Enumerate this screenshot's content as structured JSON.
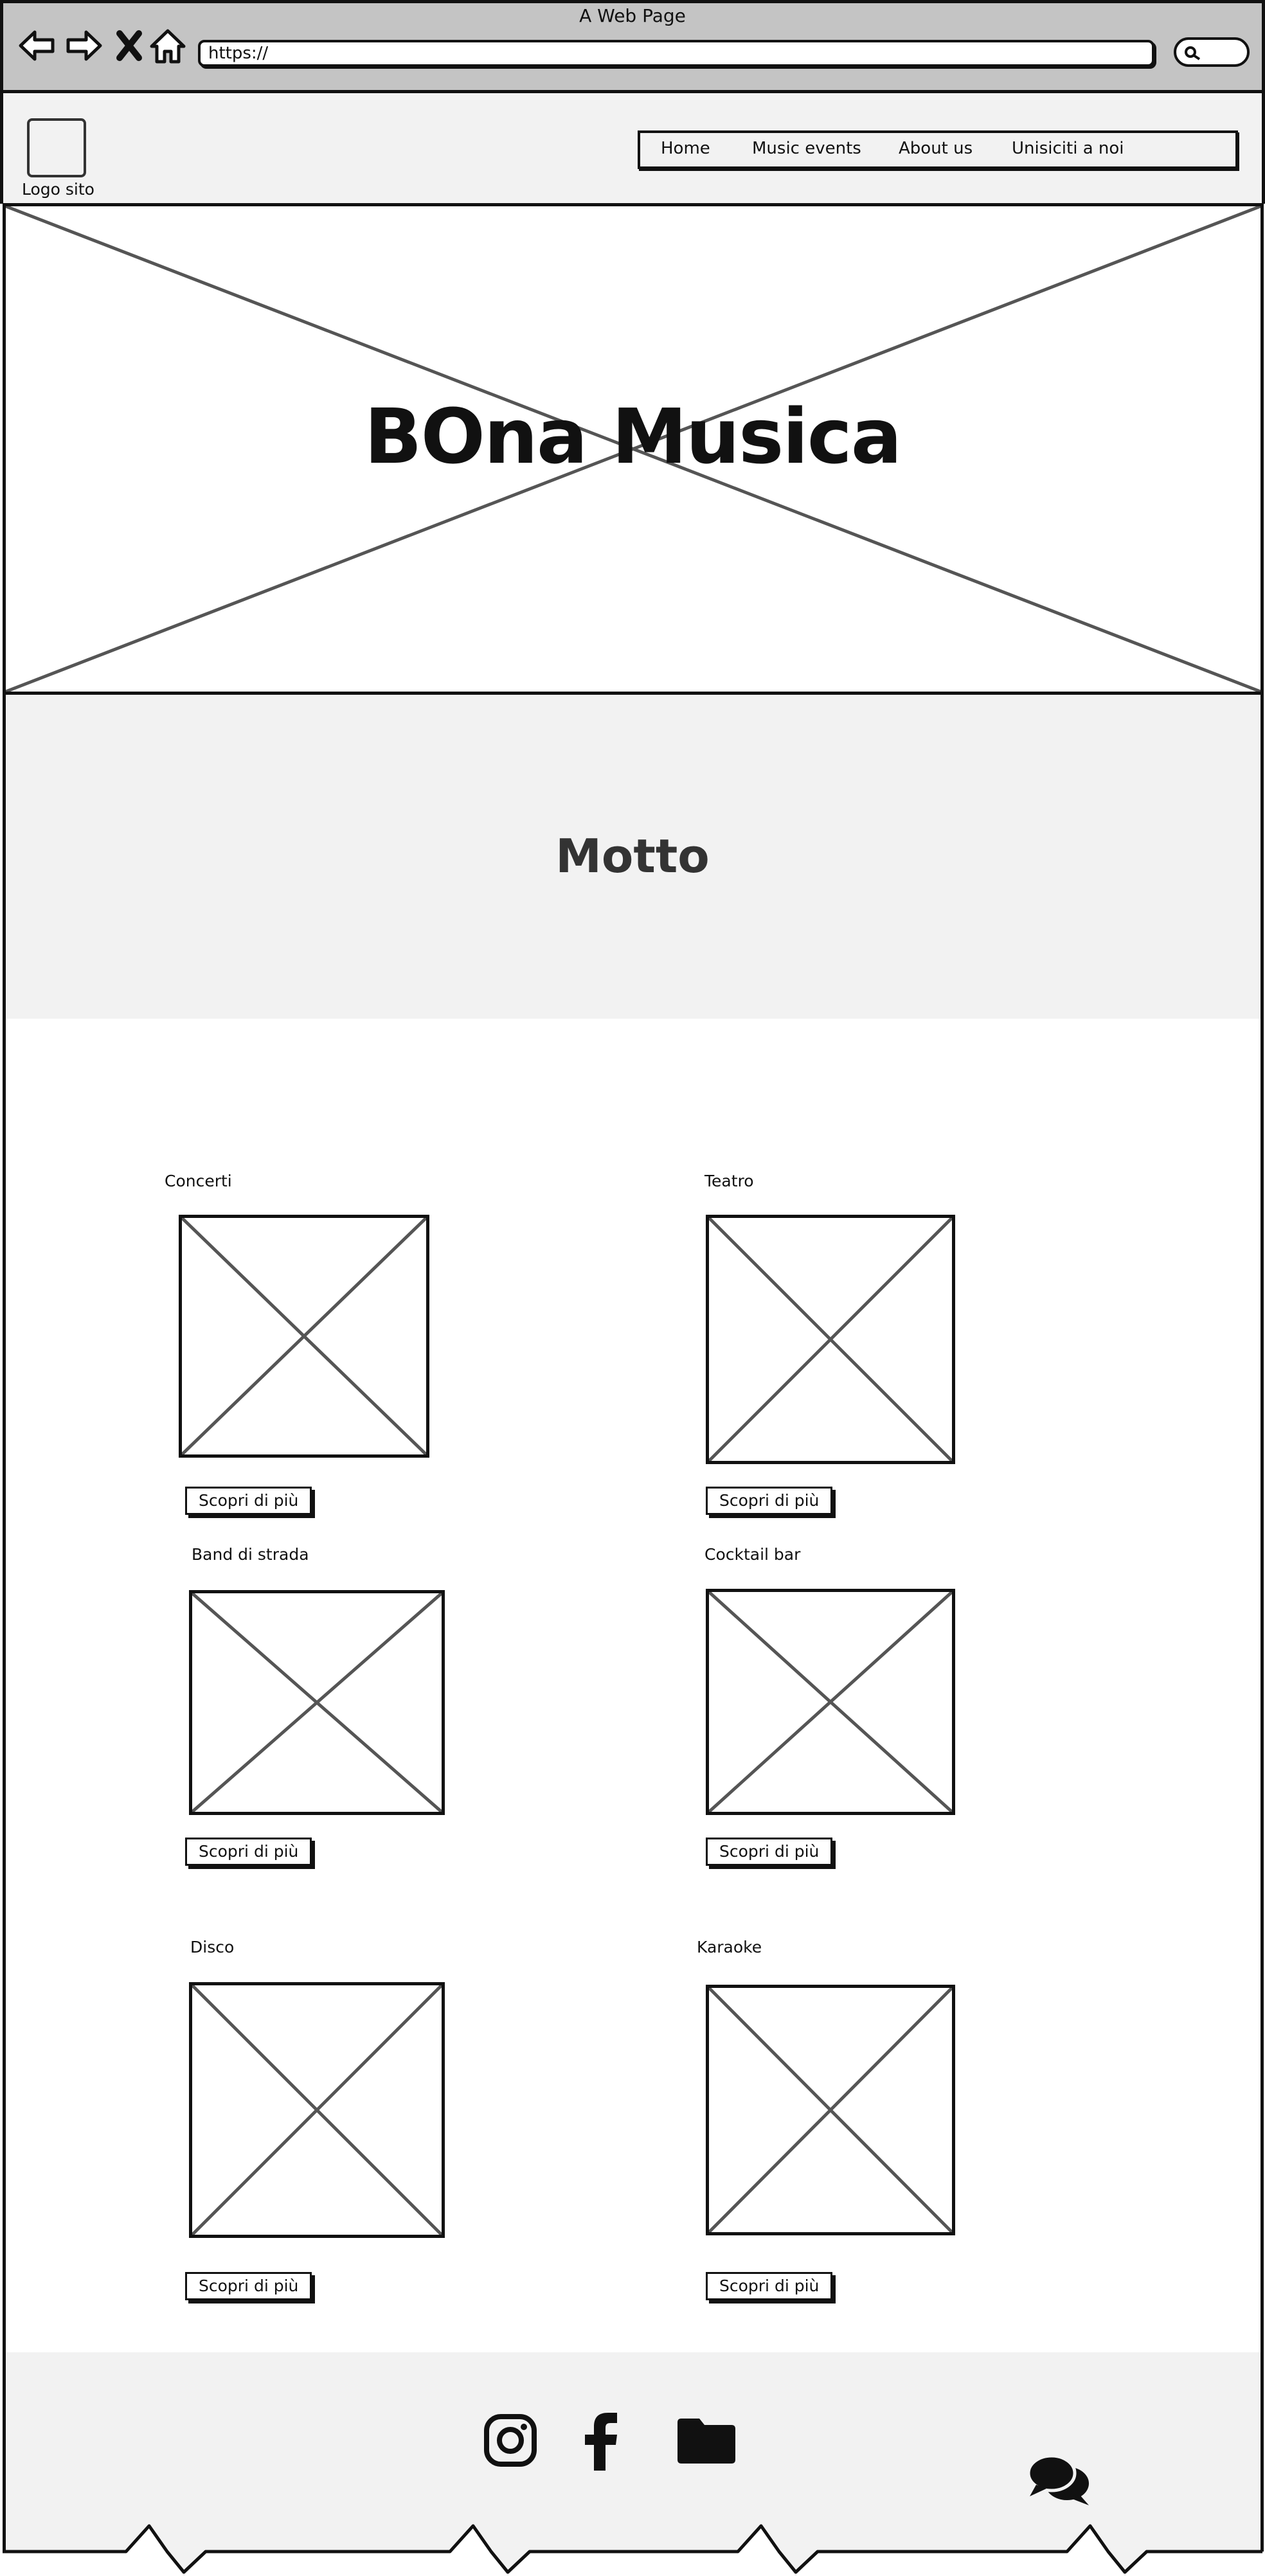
{
  "browser": {
    "window_title": "A Web Page",
    "url": "https://",
    "icons": [
      "back-arrow-icon",
      "forward-arrow-icon",
      "close-x-icon",
      "home-icon",
      "search-icon"
    ]
  },
  "header": {
    "logo_label": "Logo sito",
    "nav": [
      {
        "label": "Home"
      },
      {
        "label": "Music events"
      },
      {
        "label": "About us"
      },
      {
        "label": "Unisiciti a noi"
      }
    ]
  },
  "hero": {
    "title": "BOna Musica"
  },
  "motto": {
    "text": "Motto"
  },
  "cards": [
    {
      "label": "Concerti",
      "button": "Scopri di più"
    },
    {
      "label": "Teatro",
      "button": "Scopri di più"
    },
    {
      "label": "Band di strada",
      "button": "Scopri di più"
    },
    {
      "label": "Cocktail bar",
      "button": "Scopri di più"
    },
    {
      "label": "Disco",
      "button": "Scopri di più"
    },
    {
      "label": "Karaoke",
      "button": "Scopri di più"
    }
  ],
  "footer": {
    "icons": [
      "instagram-icon",
      "facebook-icon",
      "folder-icon",
      "chat-icon"
    ]
  },
  "colors": {
    "chrome": "#c4c4c4",
    "panel": "#f2f2f2",
    "ink": "#111111",
    "line": "#555555"
  }
}
